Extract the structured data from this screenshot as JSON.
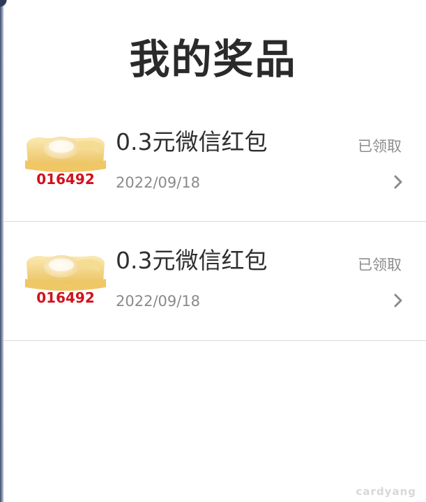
{
  "page": {
    "title": "我的奖品"
  },
  "prizes": [
    {
      "name": "0.3元微信红包",
      "date": "2022/09/18",
      "status": "已领取",
      "badge_code": "016492"
    },
    {
      "name": "0.3元微信红包",
      "date": "2022/09/18",
      "status": "已领取",
      "badge_code": "016492"
    }
  ],
  "watermark": "cardyang",
  "colors": {
    "title": "#2a2a2a",
    "status": "#8c8c8c",
    "date": "#8a8a8a",
    "divider": "#d9d9d9",
    "gold": "#f3d27a",
    "code_red": "#d0121b"
  },
  "icons": {
    "prize": "gold-ingot-icon",
    "navigate": "chevron-right-icon"
  }
}
